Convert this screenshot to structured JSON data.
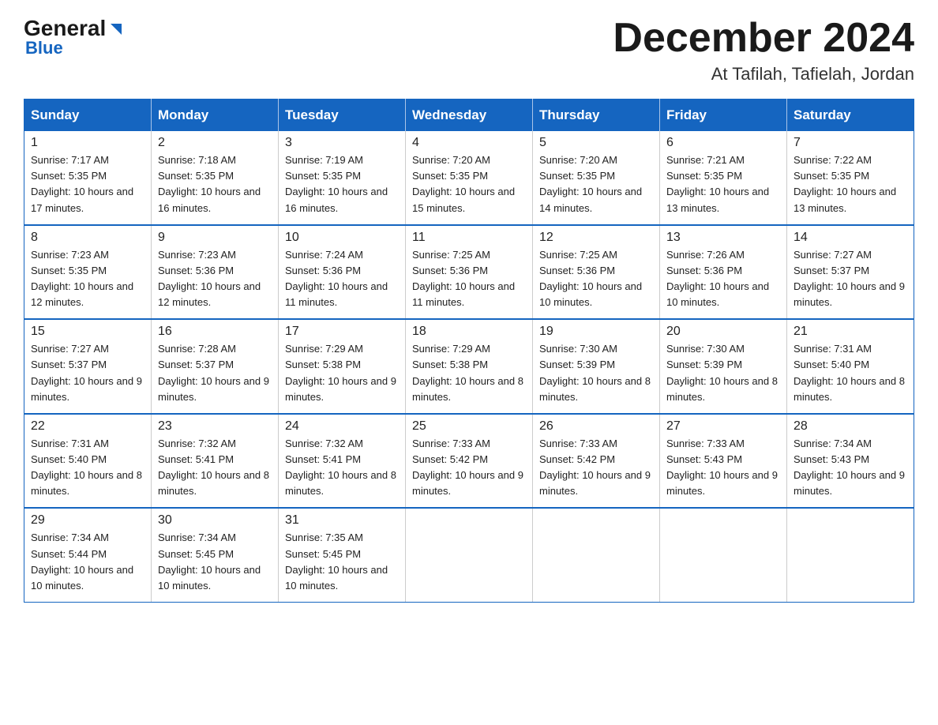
{
  "header": {
    "logo_general": "General",
    "logo_blue": "Blue",
    "month_title": "December 2024",
    "location": "At Tafilah, Tafielah, Jordan"
  },
  "days_of_week": [
    "Sunday",
    "Monday",
    "Tuesday",
    "Wednesday",
    "Thursday",
    "Friday",
    "Saturday"
  ],
  "weeks": [
    [
      {
        "day": "1",
        "sunrise": "7:17 AM",
        "sunset": "5:35 PM",
        "daylight": "10 hours and 17 minutes."
      },
      {
        "day": "2",
        "sunrise": "7:18 AM",
        "sunset": "5:35 PM",
        "daylight": "10 hours and 16 minutes."
      },
      {
        "day": "3",
        "sunrise": "7:19 AM",
        "sunset": "5:35 PM",
        "daylight": "10 hours and 16 minutes."
      },
      {
        "day": "4",
        "sunrise": "7:20 AM",
        "sunset": "5:35 PM",
        "daylight": "10 hours and 15 minutes."
      },
      {
        "day": "5",
        "sunrise": "7:20 AM",
        "sunset": "5:35 PM",
        "daylight": "10 hours and 14 minutes."
      },
      {
        "day": "6",
        "sunrise": "7:21 AM",
        "sunset": "5:35 PM",
        "daylight": "10 hours and 13 minutes."
      },
      {
        "day": "7",
        "sunrise": "7:22 AM",
        "sunset": "5:35 PM",
        "daylight": "10 hours and 13 minutes."
      }
    ],
    [
      {
        "day": "8",
        "sunrise": "7:23 AM",
        "sunset": "5:35 PM",
        "daylight": "10 hours and 12 minutes."
      },
      {
        "day": "9",
        "sunrise": "7:23 AM",
        "sunset": "5:36 PM",
        "daylight": "10 hours and 12 minutes."
      },
      {
        "day": "10",
        "sunrise": "7:24 AM",
        "sunset": "5:36 PM",
        "daylight": "10 hours and 11 minutes."
      },
      {
        "day": "11",
        "sunrise": "7:25 AM",
        "sunset": "5:36 PM",
        "daylight": "10 hours and 11 minutes."
      },
      {
        "day": "12",
        "sunrise": "7:25 AM",
        "sunset": "5:36 PM",
        "daylight": "10 hours and 10 minutes."
      },
      {
        "day": "13",
        "sunrise": "7:26 AM",
        "sunset": "5:36 PM",
        "daylight": "10 hours and 10 minutes."
      },
      {
        "day": "14",
        "sunrise": "7:27 AM",
        "sunset": "5:37 PM",
        "daylight": "10 hours and 9 minutes."
      }
    ],
    [
      {
        "day": "15",
        "sunrise": "7:27 AM",
        "sunset": "5:37 PM",
        "daylight": "10 hours and 9 minutes."
      },
      {
        "day": "16",
        "sunrise": "7:28 AM",
        "sunset": "5:37 PM",
        "daylight": "10 hours and 9 minutes."
      },
      {
        "day": "17",
        "sunrise": "7:29 AM",
        "sunset": "5:38 PM",
        "daylight": "10 hours and 9 minutes."
      },
      {
        "day": "18",
        "sunrise": "7:29 AM",
        "sunset": "5:38 PM",
        "daylight": "10 hours and 8 minutes."
      },
      {
        "day": "19",
        "sunrise": "7:30 AM",
        "sunset": "5:39 PM",
        "daylight": "10 hours and 8 minutes."
      },
      {
        "day": "20",
        "sunrise": "7:30 AM",
        "sunset": "5:39 PM",
        "daylight": "10 hours and 8 minutes."
      },
      {
        "day": "21",
        "sunrise": "7:31 AM",
        "sunset": "5:40 PM",
        "daylight": "10 hours and 8 minutes."
      }
    ],
    [
      {
        "day": "22",
        "sunrise": "7:31 AM",
        "sunset": "5:40 PM",
        "daylight": "10 hours and 8 minutes."
      },
      {
        "day": "23",
        "sunrise": "7:32 AM",
        "sunset": "5:41 PM",
        "daylight": "10 hours and 8 minutes."
      },
      {
        "day": "24",
        "sunrise": "7:32 AM",
        "sunset": "5:41 PM",
        "daylight": "10 hours and 8 minutes."
      },
      {
        "day": "25",
        "sunrise": "7:33 AM",
        "sunset": "5:42 PM",
        "daylight": "10 hours and 9 minutes."
      },
      {
        "day": "26",
        "sunrise": "7:33 AM",
        "sunset": "5:42 PM",
        "daylight": "10 hours and 9 minutes."
      },
      {
        "day": "27",
        "sunrise": "7:33 AM",
        "sunset": "5:43 PM",
        "daylight": "10 hours and 9 minutes."
      },
      {
        "day": "28",
        "sunrise": "7:34 AM",
        "sunset": "5:43 PM",
        "daylight": "10 hours and 9 minutes."
      }
    ],
    [
      {
        "day": "29",
        "sunrise": "7:34 AM",
        "sunset": "5:44 PM",
        "daylight": "10 hours and 10 minutes."
      },
      {
        "day": "30",
        "sunrise": "7:34 AM",
        "sunset": "5:45 PM",
        "daylight": "10 hours and 10 minutes."
      },
      {
        "day": "31",
        "sunrise": "7:35 AM",
        "sunset": "5:45 PM",
        "daylight": "10 hours and 10 minutes."
      },
      null,
      null,
      null,
      null
    ]
  ],
  "labels": {
    "sunrise": "Sunrise:",
    "sunset": "Sunset:",
    "daylight": "Daylight:"
  }
}
